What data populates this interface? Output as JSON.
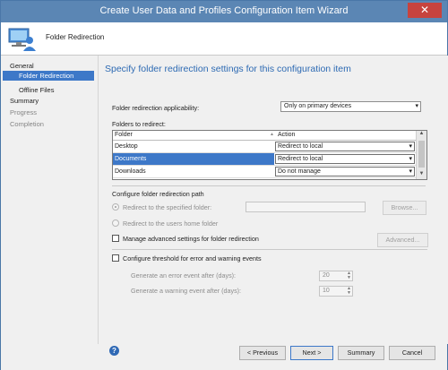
{
  "window": {
    "title": "Create User Data and Profiles Configuration Item Wizard",
    "close_glyph": "✕"
  },
  "header": {
    "title": "Folder Redirection",
    "icon": "computer-user-icon"
  },
  "nav": {
    "items": [
      {
        "label": "General"
      },
      {
        "label": "Folder Redirection"
      },
      {
        "label": "Offline Files"
      },
      {
        "label": "Summary"
      },
      {
        "label": "Progress"
      },
      {
        "label": "Completion"
      }
    ]
  },
  "main": {
    "heading": "Specify folder redirection settings for this configuration item",
    "applicability_label": "Folder redirection applicability:",
    "applicability_value": "Only on primary devices",
    "folders_label": "Folders to redirect:",
    "grid": {
      "columns": [
        "Folder",
        "Action"
      ],
      "rows": [
        {
          "folder": "Desktop",
          "action": "Redirect to local"
        },
        {
          "folder": "Documents",
          "action": "Redirect to local"
        },
        {
          "folder": "Downloads",
          "action": "Do not manage"
        }
      ]
    },
    "path_section_label": "Configure folder redirection path",
    "radio_specified": "Redirect to the specified folder:",
    "radio_home": "Redirect to the users home folder",
    "browse_button": "Browse...",
    "manage_advanced_label": "Manage advanced settings for folder redirection",
    "advanced_button": "Advanced...",
    "threshold_label": "Configure threshold for error and warning events",
    "error_event_label": "Generate an error event after (days):",
    "error_event_value": "20",
    "warning_event_label": "Generate a warning event after (days):",
    "warning_event_value": "10"
  },
  "footer": {
    "help_glyph": "?",
    "previous": "< Previous",
    "next": "Next >",
    "summary": "Summary",
    "cancel": "Cancel"
  },
  "colors": {
    "accent": "#3d78c8",
    "titlebar": "#5b86b4",
    "heading": "#2d6ab3",
    "close": "#c7433e"
  }
}
